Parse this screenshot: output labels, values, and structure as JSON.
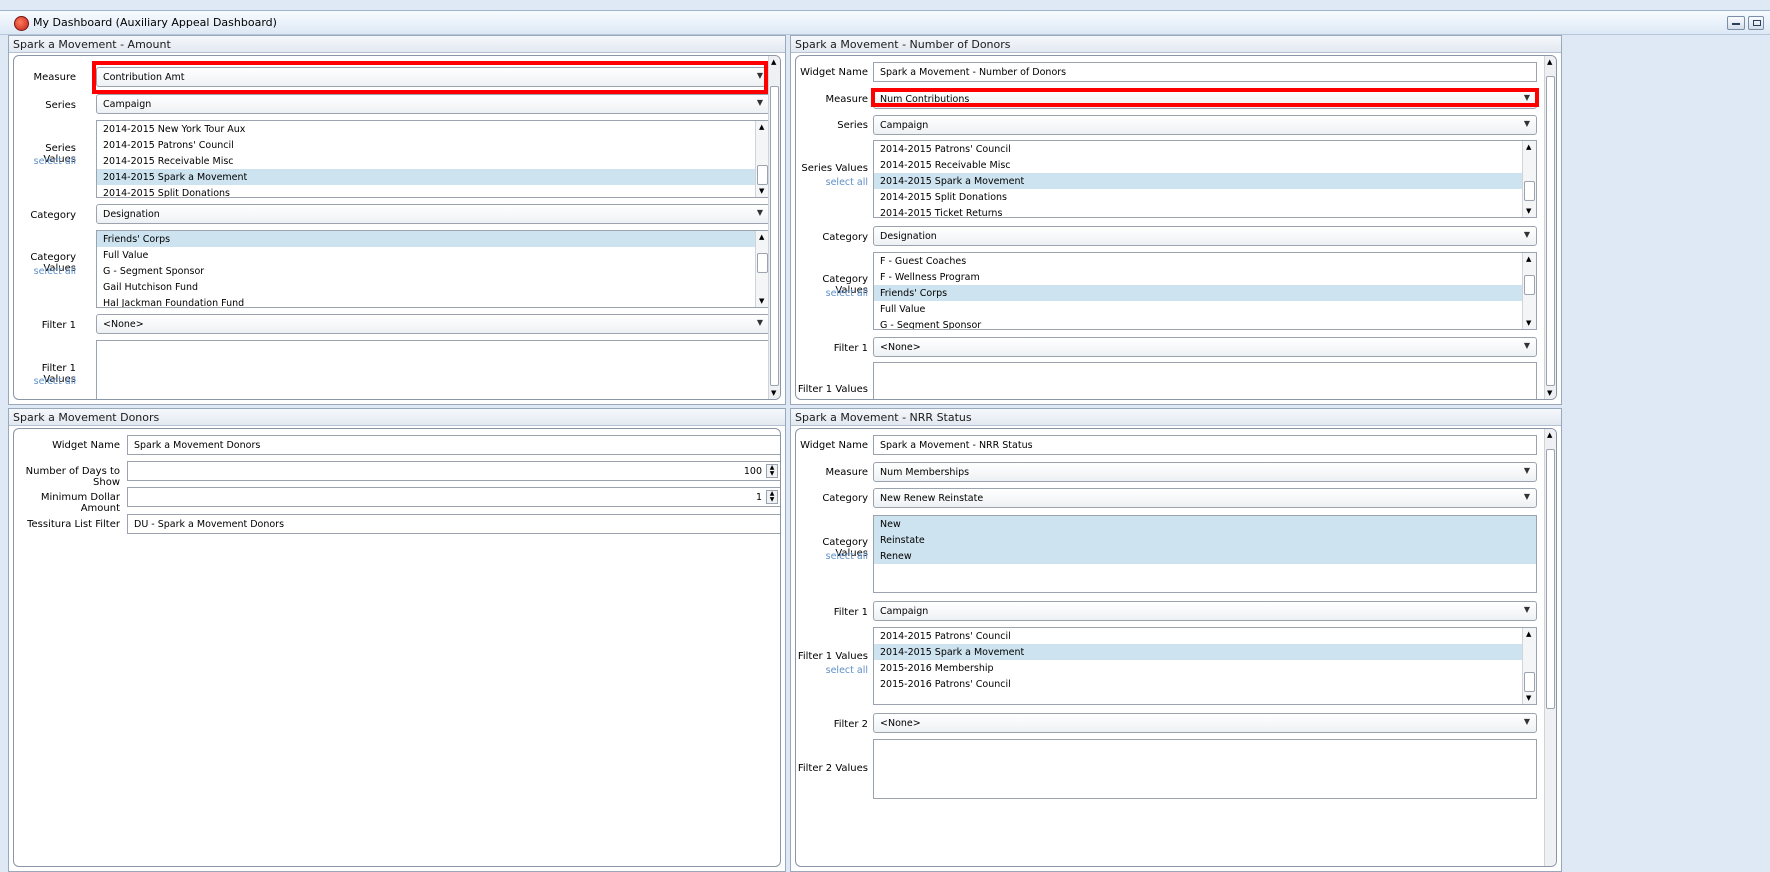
{
  "window": {
    "title": "My Dashboard (Auxiliary Appeal Dashboard)"
  },
  "panels": {
    "amount": {
      "header": "Spark a Movement - Amount",
      "measure_label": "Measure",
      "measure_value": "Contribution Amt",
      "series_label": "Series",
      "series_value": "Campaign",
      "series_values_label": "Series Values",
      "select_all": "select all",
      "series_items": [
        "2014-2015 New York Tour Aux",
        "2014-2015 Patrons' Council",
        "2014-2015 Receivable Misc",
        "2014-2015 Spark a Movement",
        "2014-2015 Split Donations"
      ],
      "category_label": "Category",
      "category_value": "Designation",
      "category_values_label": "Category Values",
      "category_items": [
        "Friends' Corps",
        "Full Value",
        "G - Segment Sponsor",
        "Gail Hutchison Fund",
        "Hal Jackman Foundation Fund"
      ],
      "filter1_label": "Filter 1",
      "filter1_value": "<None>",
      "filter1_values_label": "Filter 1 Values"
    },
    "donors_count": {
      "header": "Spark a Movement - Number of Donors",
      "widget_name_label": "Widget Name",
      "widget_name_value": "Spark a Movement - Number of Donors",
      "measure_label": "Measure",
      "measure_value": "Num Contributions",
      "series_label": "Series",
      "series_value": "Campaign",
      "series_values_label": "Series Values",
      "select_all": "select all",
      "series_items": [
        "2014-2015 Patrons' Council",
        "2014-2015 Receivable Misc",
        "2014-2015 Spark a Movement",
        "2014-2015 Split Donations",
        "2014-2015 Ticket Returns"
      ],
      "category_label": "Category",
      "category_value": "Designation",
      "category_values_label": "Category Values",
      "category_items": [
        "F - Guest Coaches",
        "F - Wellness Program",
        "Friends' Corps",
        "Full Value",
        "G - Segment Sponsor"
      ],
      "filter1_label": "Filter 1",
      "filter1_value": "<None>",
      "filter1_values_label": "Filter 1 Values"
    },
    "donors": {
      "header": "Spark a Movement Donors",
      "widget_name_label": "Widget Name",
      "widget_name_value": "Spark a Movement Donors",
      "days_label": "Number of Days to Show",
      "days_value": "100",
      "min_label": "Minimum Dollar Amount",
      "min_value": "1",
      "list_filter_label": "Tessitura List Filter",
      "list_filter_value": "DU - Spark a Movement Donors"
    },
    "nrr": {
      "header": "Spark a Movement - NRR Status",
      "widget_name_label": "Widget Name",
      "widget_name_value": "Spark a Movement - NRR Status",
      "measure_label": "Measure",
      "measure_value": "Num Memberships",
      "category_label": "Category",
      "category_value": "New Renew Reinstate",
      "category_values_label": "Category Values",
      "select_all": "select all",
      "category_items": [
        "New",
        "Reinstate",
        "Renew"
      ],
      "filter1_label": "Filter 1",
      "filter1_value": "Campaign",
      "filter1_values_label": "Filter 1 Values",
      "filter1_items": [
        "2014-2015 Patrons' Council",
        "2014-2015 Spark a Movement",
        "2015-2016 Membership",
        "2015-2016 Patrons' Council"
      ],
      "filter2_label": "Filter 2",
      "filter2_value": "<None>",
      "filter2_values_label": "Filter 2 Values"
    }
  }
}
